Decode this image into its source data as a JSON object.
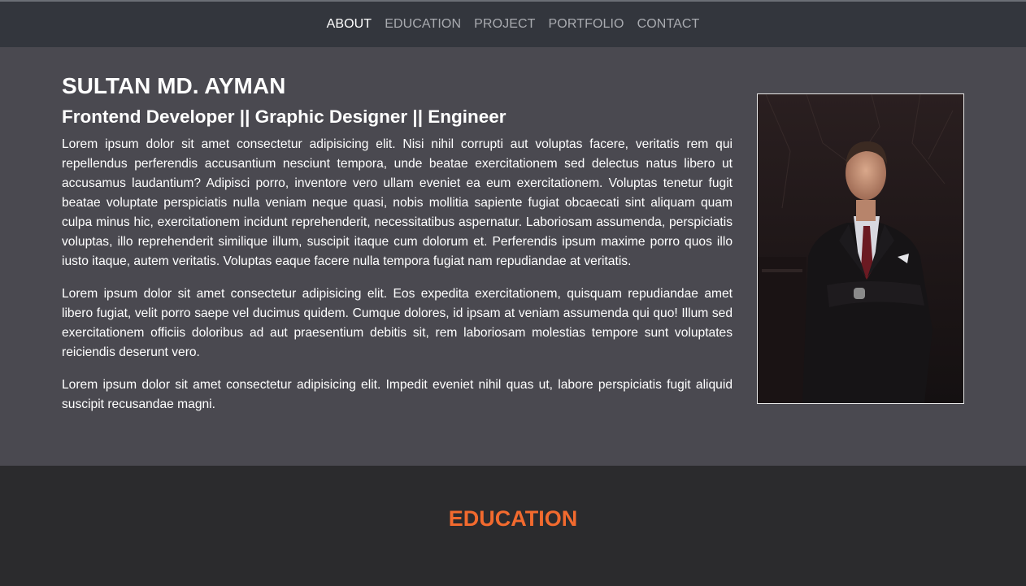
{
  "nav": {
    "items": [
      {
        "label": "ABOUT",
        "active": true
      },
      {
        "label": "EDUCATION",
        "active": false
      },
      {
        "label": "PROJECT",
        "active": false
      },
      {
        "label": "PORTFOLIO",
        "active": false
      },
      {
        "label": "CONTACT",
        "active": false
      }
    ]
  },
  "about": {
    "name": "SULTAN MD. AYMAN",
    "subtitle": "Frontend Developer || Graphic Designer || Engineer",
    "paragraphs": [
      "Lorem ipsum dolor sit amet consectetur adipisicing elit. Nisi nihil corrupti aut voluptas facere, veritatis rem qui repellendus perferendis accusantium nesciunt tempora, unde beatae exercitationem sed delectus natus libero ut accusamus laudantium? Adipisci porro, inventore vero ullam eveniet ea eum exercitationem. Voluptas tenetur fugit beatae voluptate perspiciatis nulla veniam neque quasi, nobis mollitia sapiente fugiat obcaecati sint aliquam quam culpa minus hic, exercitationem incidunt reprehenderit, necessitatibus aspernatur. Laboriosam assumenda, perspiciatis voluptas, illo reprehenderit similique illum, suscipit itaque cum dolorum et. Perferendis ipsum maxime porro quos illo iusto itaque, autem veritatis. Voluptas eaque facere nulla tempora fugiat nam repudiandae at veritatis.",
      "Lorem ipsum dolor sit amet consectetur adipisicing elit. Eos expedita exercitationem, quisquam repudiandae amet libero fugiat, velit porro saepe vel ducimus quidem. Cumque dolores, id ipsam at veniam assumenda qui quo! Illum sed exercitationem officiis doloribus ad aut praesentium debitis sit, rem laboriosam molestias tempore sunt voluptates reiciendis deserunt vero.",
      "Lorem ipsum dolor sit amet consectetur adipisicing elit. Impedit eveniet nihil quas ut, labore perspiciatis fugit aliquid suscipit recusandae magni."
    ],
    "photo_icon": "portrait-photo"
  },
  "education": {
    "title": "EDUCATION"
  },
  "colors": {
    "nav_bg": "#33363d",
    "about_bg": "#4a4950",
    "education_bg": "#2b2b2d",
    "accent": "#f26a2e"
  }
}
